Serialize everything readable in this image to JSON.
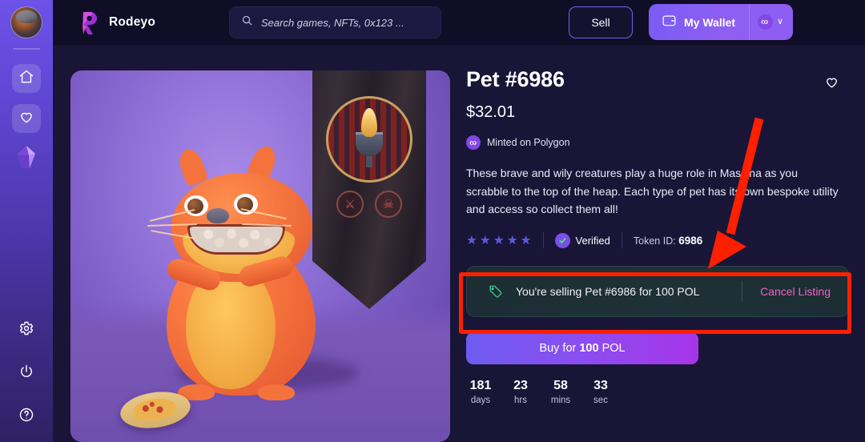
{
  "app": {
    "title": "Rodeyo"
  },
  "sidebar": {
    "avatar_name": "user-avatar",
    "items": [
      {
        "name": "home",
        "icon": "home-icon",
        "active": true
      },
      {
        "name": "favorites",
        "icon": "heart-icon",
        "active": true
      },
      {
        "name": "gems",
        "icon": "crystal-icon",
        "active": false
      }
    ],
    "bottom_items": [
      {
        "name": "settings",
        "icon": "gear-icon"
      },
      {
        "name": "logout",
        "icon": "power-icon"
      },
      {
        "name": "help",
        "icon": "question-icon"
      }
    ]
  },
  "header": {
    "brand": "Rodeyo",
    "brand_icon": "rodeyo-logo",
    "search": {
      "placeholder": "Search games, NFTs, 0x123 ...",
      "value": "",
      "icon": "search-icon"
    },
    "sell_label": "Sell",
    "wallet": {
      "label": "My Wallet",
      "icon": "wallet-icon",
      "chain_icon": "polygon-icon",
      "chevron": "∨"
    }
  },
  "nft": {
    "title": "Pet #6986",
    "price": "$32.01",
    "minted_on": "Minted on Polygon",
    "chain_icon": "polygon-icon",
    "favorite_icon": "heart-outline-icon",
    "description": "These brave and wily creatures play a huge role in Massina as you scrabble to the top of the heap. Each type of pet has its own bespoke utility and access so collect them all!",
    "rating": 5,
    "star_glyph": "★",
    "verified_label": "Verified",
    "verified_icon": "check-badge-icon",
    "token_id_label": "Token ID:",
    "token_id": "6986",
    "artwork_alt": "orange hamster pet with pizza slice and banner"
  },
  "listing": {
    "tag_icon": "tag-icon",
    "message": "You're selling Pet #6986 for 100 POL",
    "cancel_label": "Cancel Listing"
  },
  "buy": {
    "prefix": "Buy for",
    "amount": "100",
    "currency": "POL"
  },
  "countdown": [
    {
      "value": "181",
      "label": "days"
    },
    {
      "value": "23",
      "label": "hrs"
    },
    {
      "value": "58",
      "label": "mins"
    },
    {
      "value": "33",
      "label": "sec"
    }
  ],
  "annotations": {
    "highlight_color": "#fb2000",
    "arrow_color": "#fb2000",
    "highlight_target": "selling-banner",
    "arrow_points_to": "selling-banner"
  },
  "colors": {
    "page_bg": "#191537",
    "header_bg": "#100d26",
    "sidebar_top": "#6d52e8",
    "accent_purple": "#7a5cf5",
    "accent_magenta": "#a635e8",
    "cancel_pink": "#f060c0",
    "listing_green": "#3ec98a",
    "star_blue": "#5b5ae0"
  }
}
